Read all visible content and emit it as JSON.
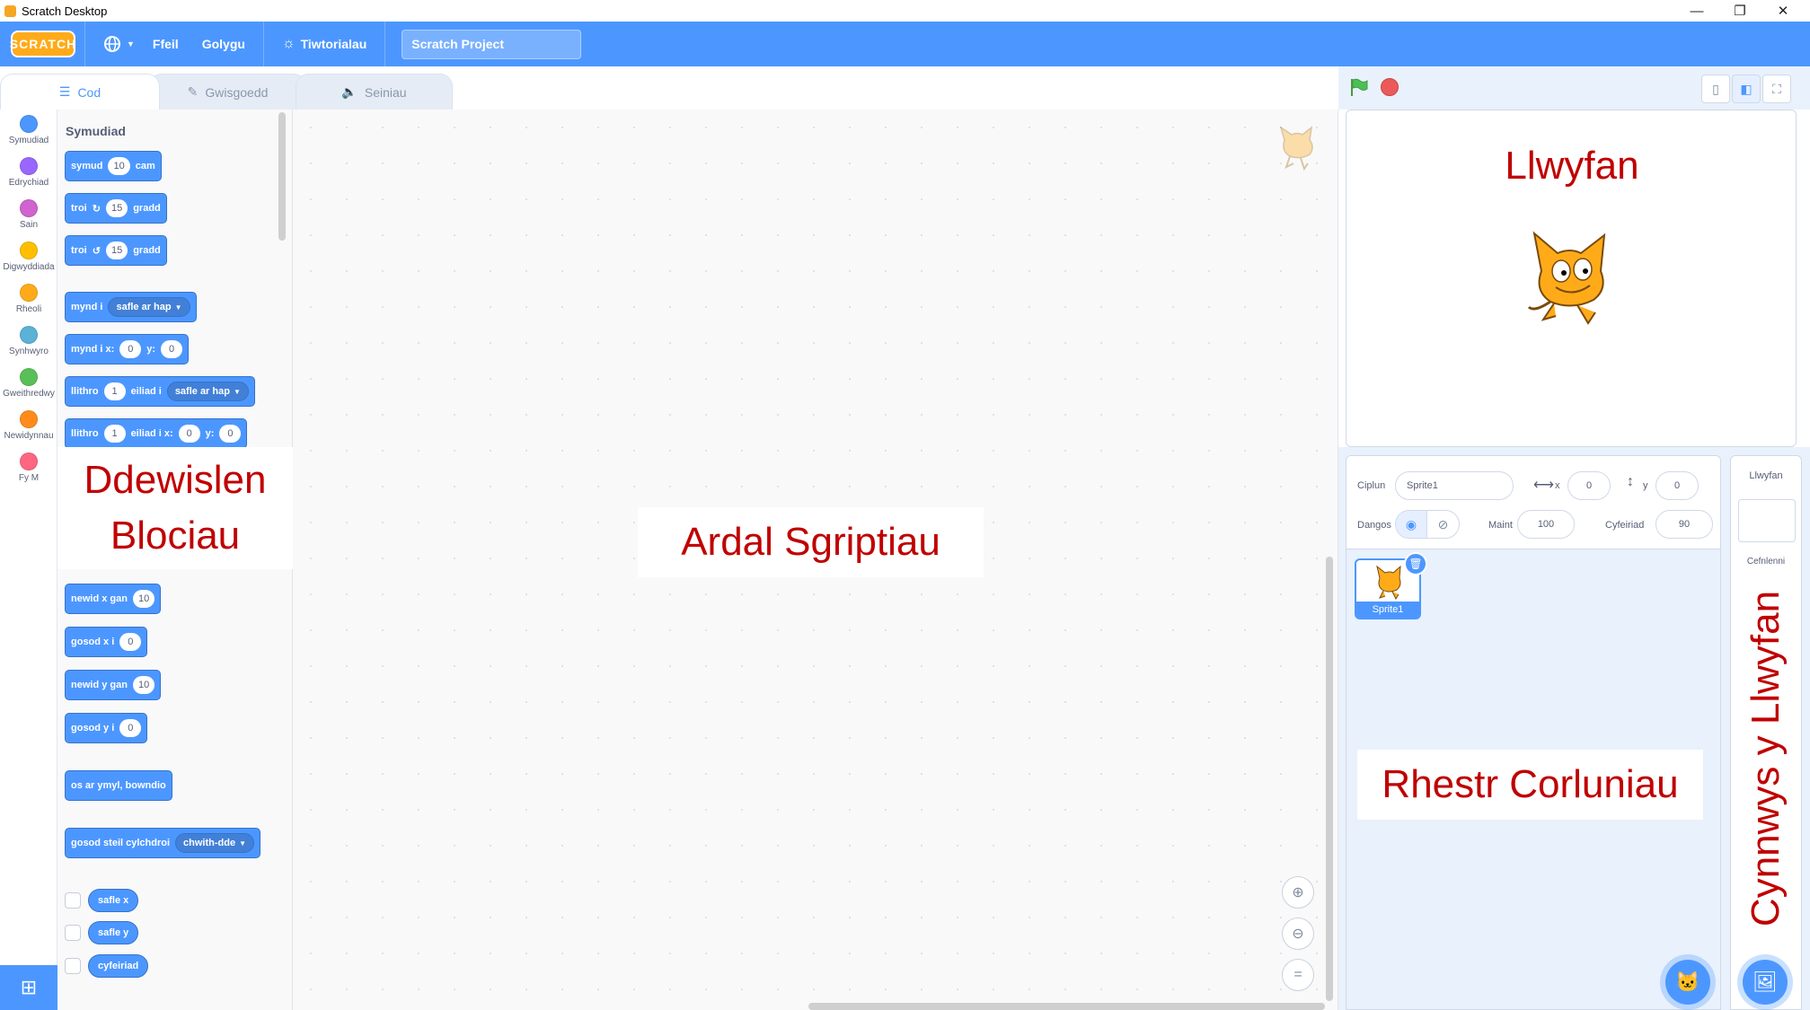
{
  "window": {
    "title": "Scratch Desktop",
    "minimize": "—",
    "restore": "❐",
    "close": "✕"
  },
  "menubar": {
    "logo": "SCRATCH",
    "language_icon": "globe-icon",
    "file": "Ffeil",
    "edit": "Golygu",
    "tutorials": "Tiwtorialau",
    "project_title": "Scratch Project"
  },
  "tabs": [
    {
      "label": "Cod",
      "icon": "code-icon",
      "active": true
    },
    {
      "label": "Gwisgoedd",
      "icon": "brush-icon",
      "active": false
    },
    {
      "label": "Seiniau",
      "icon": "speaker-icon",
      "active": false
    }
  ],
  "categories": [
    {
      "label": "Symudiad",
      "color": "#4c97ff"
    },
    {
      "label": "Edrychiad",
      "color": "#9966ff"
    },
    {
      "label": "Sain",
      "color": "#cf63cf"
    },
    {
      "label": "Digwyddiada",
      "color": "#ffbf00"
    },
    {
      "label": "Rheoli",
      "color": "#ffab19"
    },
    {
      "label": "Synhwyro",
      "color": "#5cb1d6"
    },
    {
      "label": "Gweithredwy",
      "color": "#59c059"
    },
    {
      "label": "Newidynnau",
      "color": "#ff8c1a"
    },
    {
      "label": "Fy M",
      "color": "#ff6680"
    }
  ],
  "palette": {
    "heading": "Symudiad",
    "blocks": {
      "move": {
        "a": "symud",
        "v": "10",
        "b": "cam"
      },
      "turn_right": {
        "a": "troi",
        "v": "15",
        "b": "gradd"
      },
      "turn_left": {
        "a": "troi",
        "v": "15",
        "b": "gradd"
      },
      "goto": {
        "a": "mynd i",
        "dd": "safle ar hap"
      },
      "goto_xy": {
        "a": "mynd i x:",
        "x": "0",
        "b": "y:",
        "y": "0"
      },
      "glide": {
        "a": "llithro",
        "v": "1",
        "b": "eiliad i",
        "dd": "safle ar hap"
      },
      "glide_xy": {
        "a": "llithro",
        "v": "1",
        "b": "eiliad i x:",
        "x": "0",
        "c": "y:",
        "y": "0"
      },
      "change_x": {
        "a": "newid x gan",
        "v": "10"
      },
      "set_x": {
        "a": "gosod x i",
        "v": "0"
      },
      "change_y": {
        "a": "newid y gan",
        "v": "10"
      },
      "set_y": {
        "a": "gosod y i",
        "v": "0"
      },
      "bounce": {
        "a": "os ar ymyl, bowndio"
      },
      "rotation_style": {
        "a": "gosod steil cylchdroi",
        "dd": "chwith-dde"
      }
    },
    "reporters": [
      "safle x",
      "safle y",
      "cyfeiriad"
    ]
  },
  "sprite_info": {
    "sprite_label": "Ciplun",
    "sprite_name": "Sprite1",
    "x_label": "x",
    "x_value": "0",
    "y_label": "y",
    "y_value": "0",
    "show_label": "Dangos",
    "size_label": "Maint",
    "size_value": "100",
    "direction_label": "Cyfeiriad",
    "direction_value": "90"
  },
  "sprites": [
    {
      "name": "Sprite1"
    }
  ],
  "stage_pane": {
    "title": "Llwyfan",
    "backdrops_label": "Cefnlenni"
  },
  "annotations": {
    "blocks_menu_line1": "Ddewislen",
    "blocks_menu_line2": "Blociau",
    "script_area": "Ardal Sgriptiau",
    "stage": "Llwyfan",
    "sprite_list": "Rhestr Corluniau",
    "stage_contents": "Cynnwys y Llwyfan"
  },
  "colors": {
    "menubar": "#4c97ff",
    "motion": "#4c97ff",
    "annotation": "#c00000",
    "stop": "#ec5959",
    "flag": "#4cbf56"
  }
}
